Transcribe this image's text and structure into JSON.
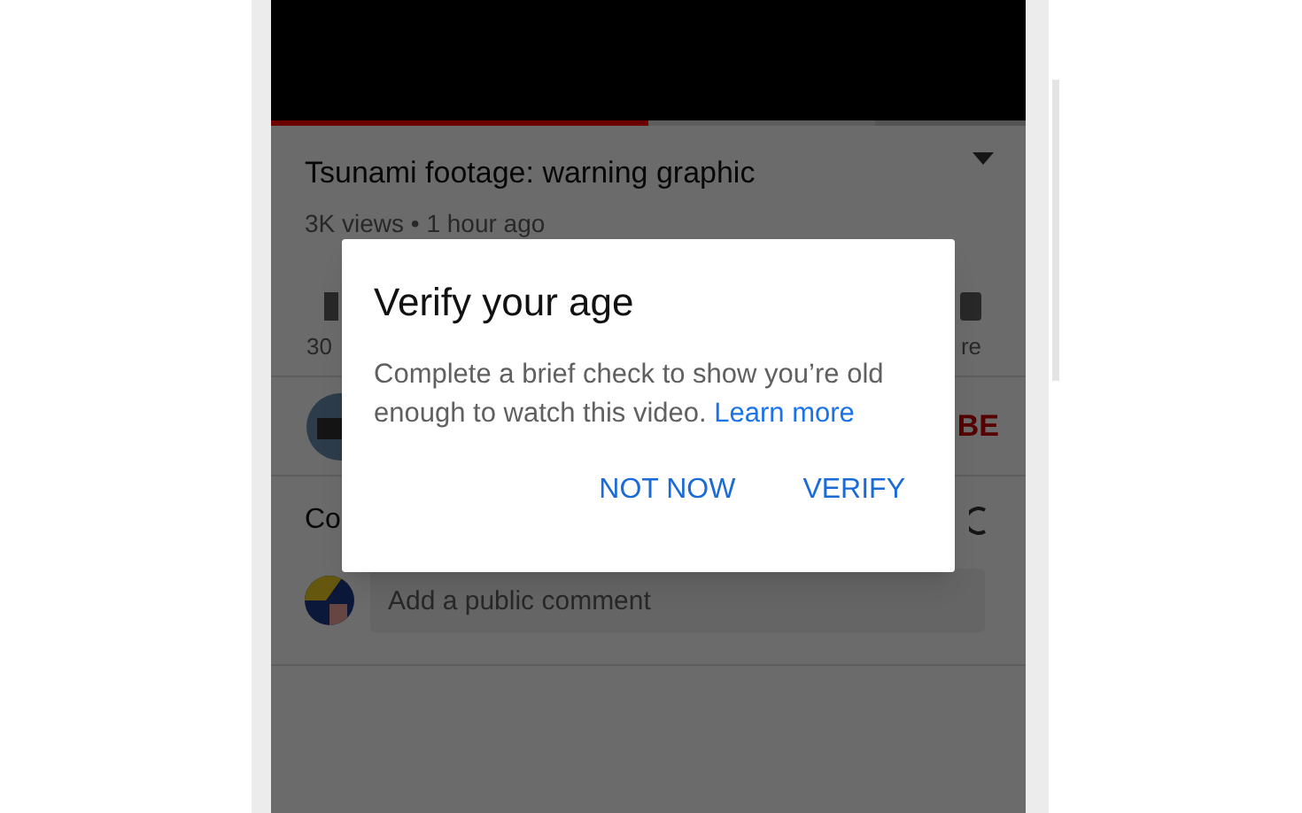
{
  "video": {
    "playback_bar": {
      "level": 0.5
    },
    "buffer_bar": {
      "level": 0.8
    }
  },
  "title": "Tsunami footage: warning graphic",
  "meta": "3K views • 1 hour ago",
  "actions": {
    "left_label": "30",
    "right_label": "re"
  },
  "channel": {
    "subscribe_label": "BE"
  },
  "comments": {
    "heading": "Co",
    "field": {
      "placeholder": "Add a public comment"
    }
  },
  "dialog": {
    "title": "Verify your age",
    "body": "Complete a brief check to show you’re old enough to watch this video.",
    "link": "Learn more",
    "buttons": [
      "NOT NOW",
      "VERIFY"
    ]
  }
}
